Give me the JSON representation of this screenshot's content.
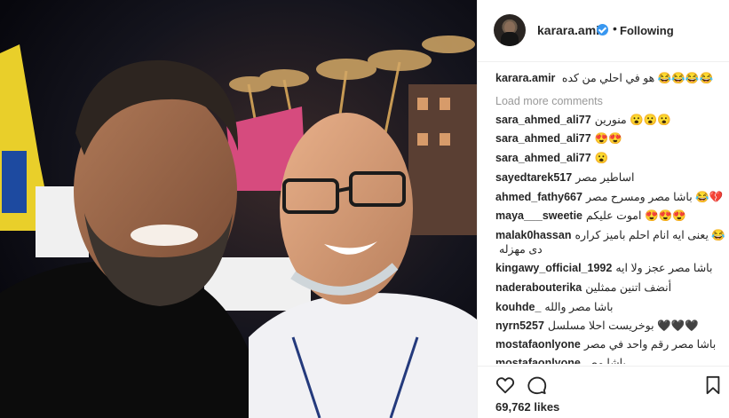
{
  "post": {
    "author": "karara.amir",
    "follow_status": "Following",
    "caption": "هو في احلي من كده 😂😂😂😂",
    "load_more": "Load more comments",
    "likes": "69,762 likes"
  },
  "comments": [
    {
      "user": "sara_ahmed_ali77",
      "text": "منورين 😮😮😮"
    },
    {
      "user": "sara_ahmed_ali77",
      "text": "😍😍"
    },
    {
      "user": "sara_ahmed_ali77",
      "text": "😮"
    },
    {
      "user": "sayedtarek517",
      "text": "اساطير مصر"
    },
    {
      "user": "ahmed_fathy667",
      "text": "باشا مصر ومسرح مصر 😂💔"
    },
    {
      "user": "maya___sweetie",
      "text": "اموت عليكم 😍😍😍"
    },
    {
      "user": "malak0hassan",
      "text": "يعنى ايه انام احلم باميز كراره 😂😂"
    },
    {
      "user": "",
      "text": "دى مهزله"
    },
    {
      "user": "kingawy_official_1992",
      "text": "باشا مصر عجز ولا ايه"
    },
    {
      "user": "naderabouterika",
      "text": "أنضف اتنين ممثلين"
    },
    {
      "user": "kouhde_",
      "text": "باشا مصر والله"
    },
    {
      "user": "nyrn5257",
      "text": "بوخريست احلا مسلسل 🖤🖤🖤"
    },
    {
      "user": "mostafaonlyone",
      "text": "باشا مصر رقم واحد في مصر"
    },
    {
      "user": "mostafaonlyone",
      "text": "باشا مص..."
    }
  ],
  "icons": {
    "like": "heart-icon",
    "comment": "comment-icon",
    "save": "bookmark-icon",
    "verified": "verified-badge-icon"
  },
  "colors": {
    "verified_blue": "#3897f0",
    "muted_text": "#999999"
  }
}
